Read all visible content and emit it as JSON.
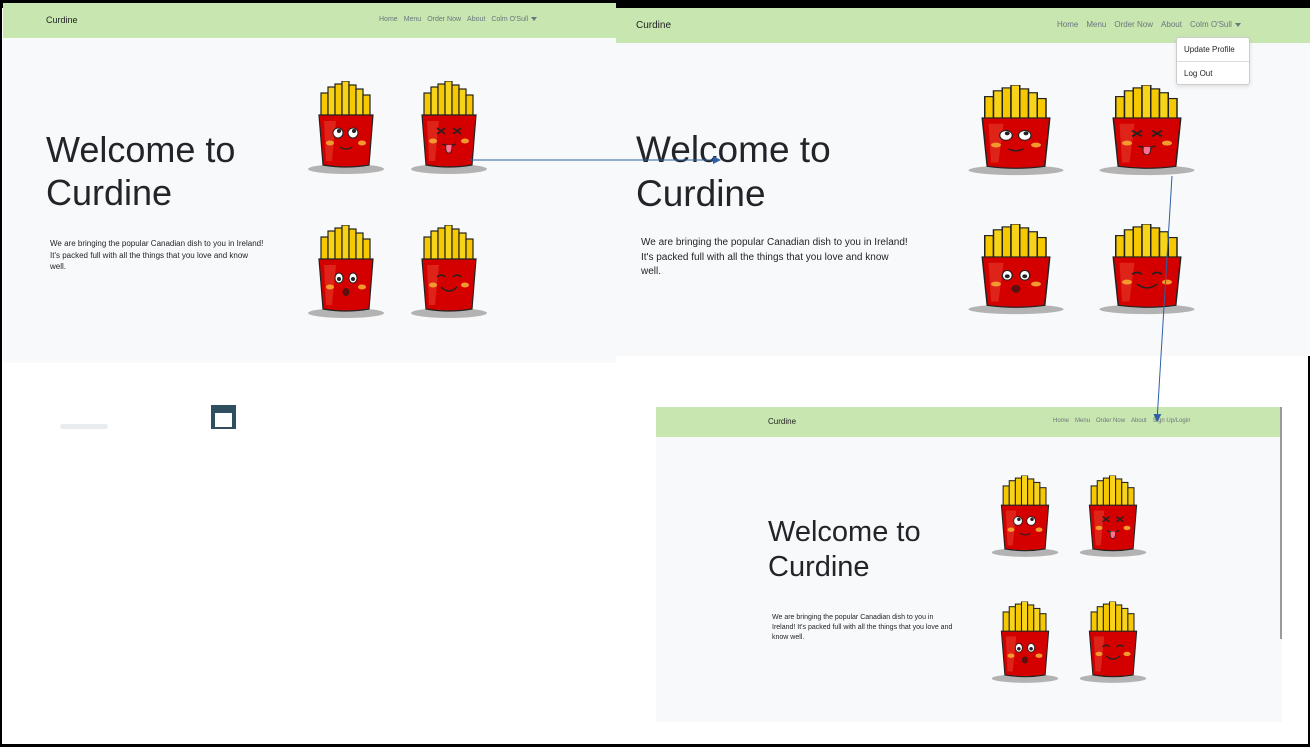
{
  "screens": {
    "left": {
      "brand": "Curdine",
      "nav": [
        "Home",
        "Menu",
        "Order Now",
        "About",
        "Colm O'Sull"
      ],
      "title_line1": "Welcome to",
      "title_line2": "Curdine",
      "tagline": "We are bringing the popular Canadian dish to you in Ireland! It's packed full with all the things that you love and know well."
    },
    "right_top": {
      "brand": "Curdine",
      "nav": [
        "Home",
        "Menu",
        "Order Now",
        "About",
        "Colm O'Sull"
      ],
      "dropdown": [
        "Update Profile",
        "Log Out"
      ],
      "title_line1": "Welcome to",
      "title_line2": "Curdine",
      "tagline": "We are bringing the popular Canadian dish to you in Ireland! It's packed full with all the things that you love and know well."
    },
    "right_bottom": {
      "brand": "Curdine",
      "nav": [
        "Home",
        "Menu",
        "Order Now",
        "About",
        "Sign Up/Login"
      ],
      "title_line1": "Welcome to",
      "title_line2": "Curdine",
      "tagline": "We are bringing the popular Canadian dish to you in Ireland! It's packed full with all the things that you love and know well."
    }
  },
  "colors": {
    "navbar": "#c8e6b0",
    "page": "#f8f9fa",
    "fries_cup": "#d40000",
    "fries_stick": "#f5c800",
    "arrow": "#2e5fa8"
  },
  "icons": [
    "fries-icon",
    "caret-down-icon"
  ]
}
